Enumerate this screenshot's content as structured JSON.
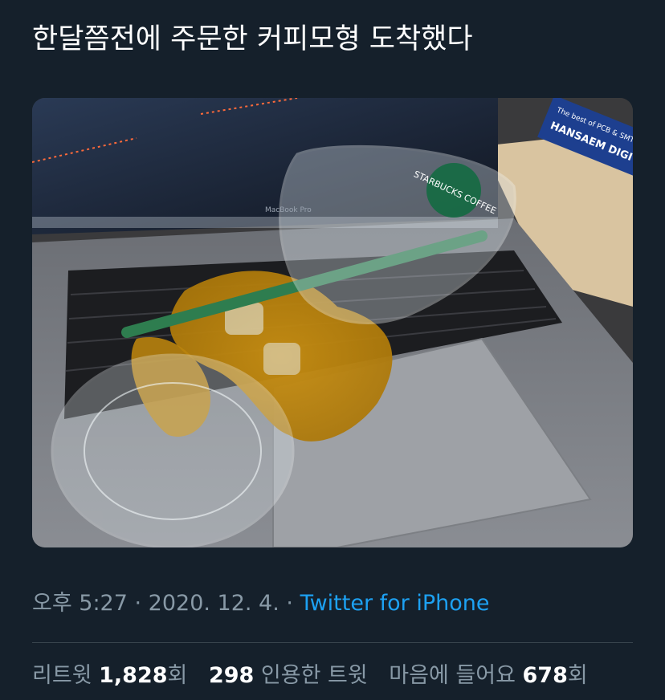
{
  "tweet": {
    "text": "한달쯤전에 주문한 커피모형 도착했다"
  },
  "media": {
    "photo_laptop_label": "MacBook Pro",
    "photo_cup_logo": "STARBUCKS COFFEE",
    "photo_sign_text": "HANSAEM DIGITEC",
    "photo_sign_tagline": "The best of PCB & SMT"
  },
  "meta": {
    "time": "오후 5:27",
    "separator": " · ",
    "date": "2020. 12. 4.",
    "separator2": " · ",
    "source": "Twitter for iPhone"
  },
  "stats": {
    "retweets_label": "리트윗 ",
    "retweets_count": "1,828",
    "retweets_suffix": "회",
    "quotes_count": "298",
    "quotes_label": " 인용한 트윗",
    "likes_label": "마음에 들어요 ",
    "likes_count": "678",
    "likes_suffix": "회"
  },
  "colors": {
    "background": "#15202b",
    "text_primary": "#ffffff",
    "text_secondary": "#8899a6",
    "link": "#1da1f2",
    "divider": "#38444d"
  }
}
